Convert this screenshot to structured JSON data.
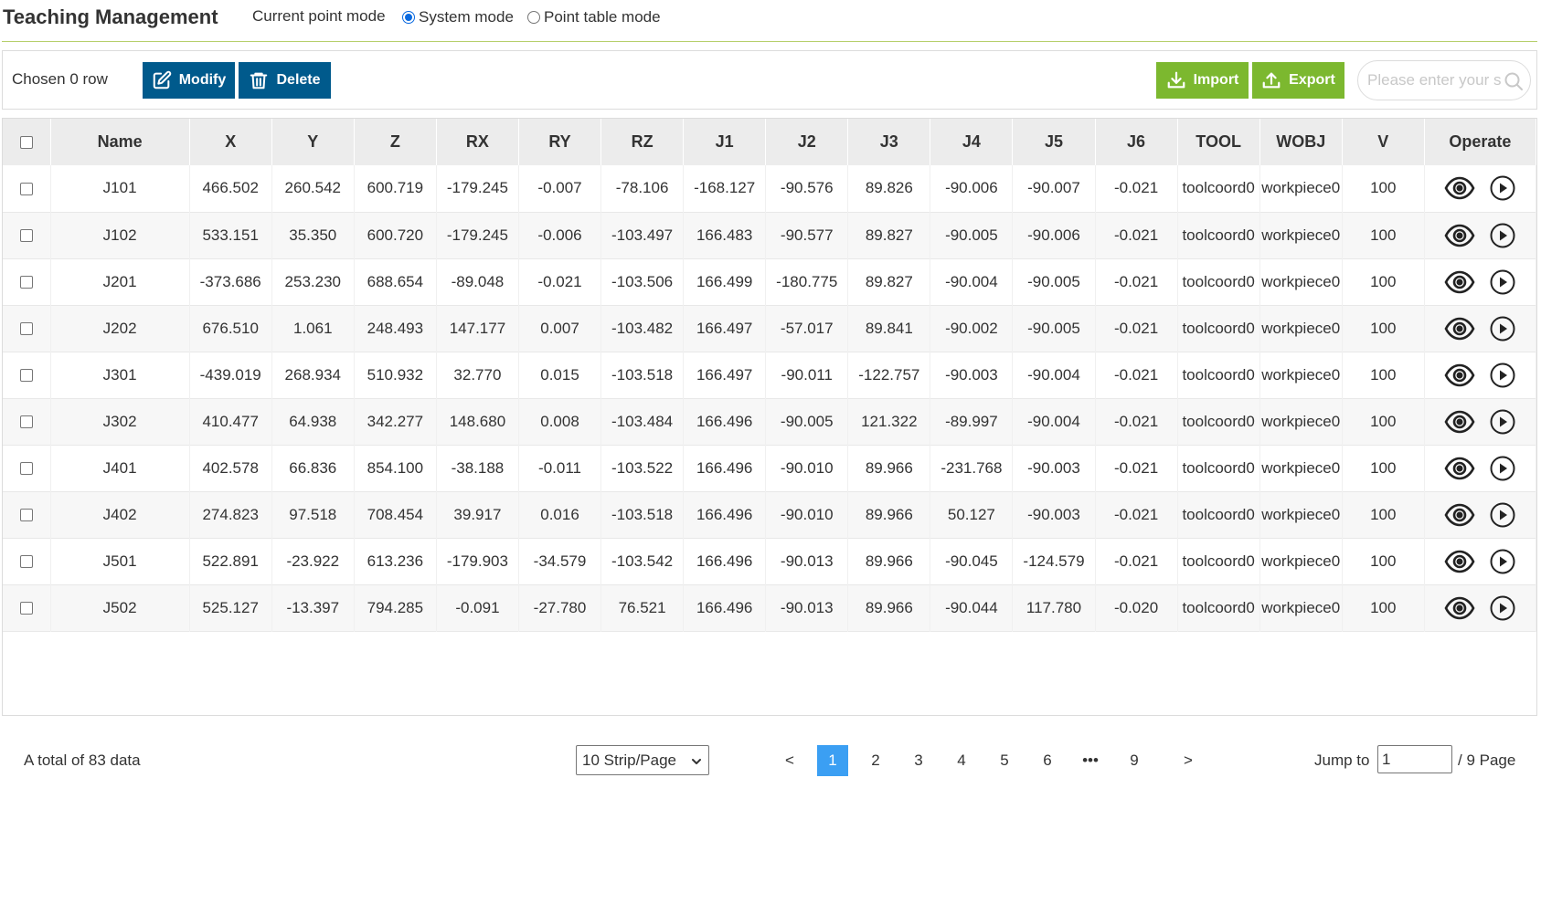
{
  "header": {
    "title": "Teaching Management",
    "mode_label": "Current point mode",
    "modes": [
      {
        "label": "System mode",
        "checked": true
      },
      {
        "label": "Point table mode",
        "checked": false
      }
    ]
  },
  "toolbar": {
    "chosen_text": "Chosen 0 row",
    "modify_label": "Modify",
    "delete_label": "Delete",
    "import_label": "Import",
    "export_label": "Export",
    "search_placeholder": "Please enter your s",
    "colors": {
      "primary": "#005a8c",
      "success": "#7cb82f",
      "accent": "#3b9ff3"
    }
  },
  "table": {
    "columns": [
      "Name",
      "X",
      "Y",
      "Z",
      "RX",
      "RY",
      "RZ",
      "J1",
      "J2",
      "J3",
      "J4",
      "J5",
      "J6",
      "TOOL",
      "WOBJ",
      "V",
      "Operate"
    ],
    "rows": [
      [
        "J101",
        "466.502",
        "260.542",
        "600.719",
        "-179.245",
        "-0.007",
        "-78.106",
        "-168.127",
        "-90.576",
        "89.826",
        "-90.006",
        "-90.007",
        "-0.021",
        "toolcoord0",
        "workpiece0",
        "100"
      ],
      [
        "J102",
        "533.151",
        "35.350",
        "600.720",
        "-179.245",
        "-0.006",
        "-103.497",
        "166.483",
        "-90.577",
        "89.827",
        "-90.005",
        "-90.006",
        "-0.021",
        "toolcoord0",
        "workpiece0",
        "100"
      ],
      [
        "J201",
        "-373.686",
        "253.230",
        "688.654",
        "-89.048",
        "-0.021",
        "-103.506",
        "166.499",
        "-180.775",
        "89.827",
        "-90.004",
        "-90.005",
        "-0.021",
        "toolcoord0",
        "workpiece0",
        "100"
      ],
      [
        "J202",
        "676.510",
        "1.061",
        "248.493",
        "147.177",
        "0.007",
        "-103.482",
        "166.497",
        "-57.017",
        "89.841",
        "-90.002",
        "-90.005",
        "-0.021",
        "toolcoord0",
        "workpiece0",
        "100"
      ],
      [
        "J301",
        "-439.019",
        "268.934",
        "510.932",
        "32.770",
        "0.015",
        "-103.518",
        "166.497",
        "-90.011",
        "-122.757",
        "-90.003",
        "-90.004",
        "-0.021",
        "toolcoord0",
        "workpiece0",
        "100"
      ],
      [
        "J302",
        "410.477",
        "64.938",
        "342.277",
        "148.680",
        "0.008",
        "-103.484",
        "166.496",
        "-90.005",
        "121.322",
        "-89.997",
        "-90.004",
        "-0.021",
        "toolcoord0",
        "workpiece0",
        "100"
      ],
      [
        "J401",
        "402.578",
        "66.836",
        "854.100",
        "-38.188",
        "-0.011",
        "-103.522",
        "166.496",
        "-90.010",
        "89.966",
        "-231.768",
        "-90.003",
        "-0.021",
        "toolcoord0",
        "workpiece0",
        "100"
      ],
      [
        "J402",
        "274.823",
        "97.518",
        "708.454",
        "39.917",
        "0.016",
        "-103.518",
        "166.496",
        "-90.010",
        "89.966",
        "50.127",
        "-90.003",
        "-0.021",
        "toolcoord0",
        "workpiece0",
        "100"
      ],
      [
        "J501",
        "522.891",
        "-23.922",
        "613.236",
        "-179.903",
        "-34.579",
        "-103.542",
        "166.496",
        "-90.013",
        "89.966",
        "-90.045",
        "-124.579",
        "-0.021",
        "toolcoord0",
        "workpiece0",
        "100"
      ],
      [
        "J502",
        "525.127",
        "-13.397",
        "794.285",
        "-0.091",
        "-27.780",
        "76.521",
        "166.496",
        "-90.013",
        "89.966",
        "-90.044",
        "117.780",
        "-0.020",
        "toolcoord0",
        "workpiece0",
        "100"
      ]
    ],
    "row_icons": [
      "eye-icon",
      "play-icon"
    ]
  },
  "pagination": {
    "total_text": "A total of 83 data",
    "page_size": "10 Strip/Page",
    "prev": "<",
    "next": ">",
    "pages": [
      "1",
      "2",
      "3",
      "4",
      "5",
      "6",
      "•••",
      "9"
    ],
    "current_page": "1",
    "jump_label": "Jump to",
    "jump_value": "1",
    "page_total": "/ 9 Page"
  }
}
